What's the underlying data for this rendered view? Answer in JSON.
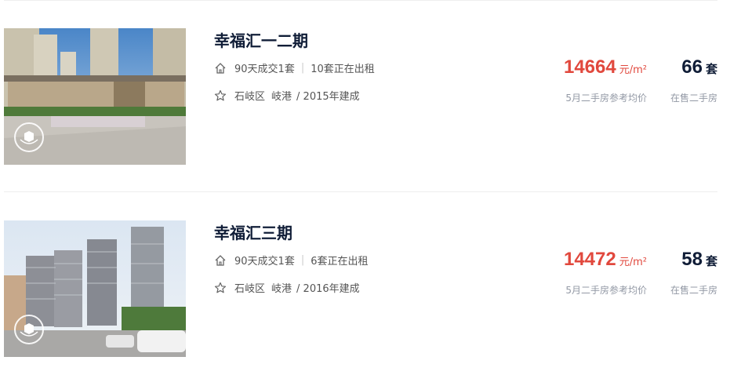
{
  "listings": [
    {
      "name": "幸福汇一二期",
      "deals": "90天成交1套",
      "rent": "10套正在出租",
      "district": "石岐区",
      "area": "岐港",
      "built": "/ 2015年建成",
      "price": "14664",
      "price_unit": "元/m²",
      "price_label": "5月二手房参考均价",
      "count": "66",
      "count_unit": "套",
      "count_label": "在售二手房"
    },
    {
      "name": "幸福汇三期",
      "deals": "90天成交1套",
      "rent": "6套正在出租",
      "district": "石岐区",
      "area": "岐港",
      "built": "/ 2016年建成",
      "price": "14472",
      "price_unit": "元/m²",
      "price_label": "5月二手房参考均价",
      "count": "58",
      "count_unit": "套",
      "count_label": "在售二手房"
    }
  ],
  "colors": {
    "title": "#101d37",
    "price": "#e1483d",
    "muted": "#9399a5"
  },
  "icons": [
    "house-icon",
    "star-icon",
    "vr-icon"
  ]
}
